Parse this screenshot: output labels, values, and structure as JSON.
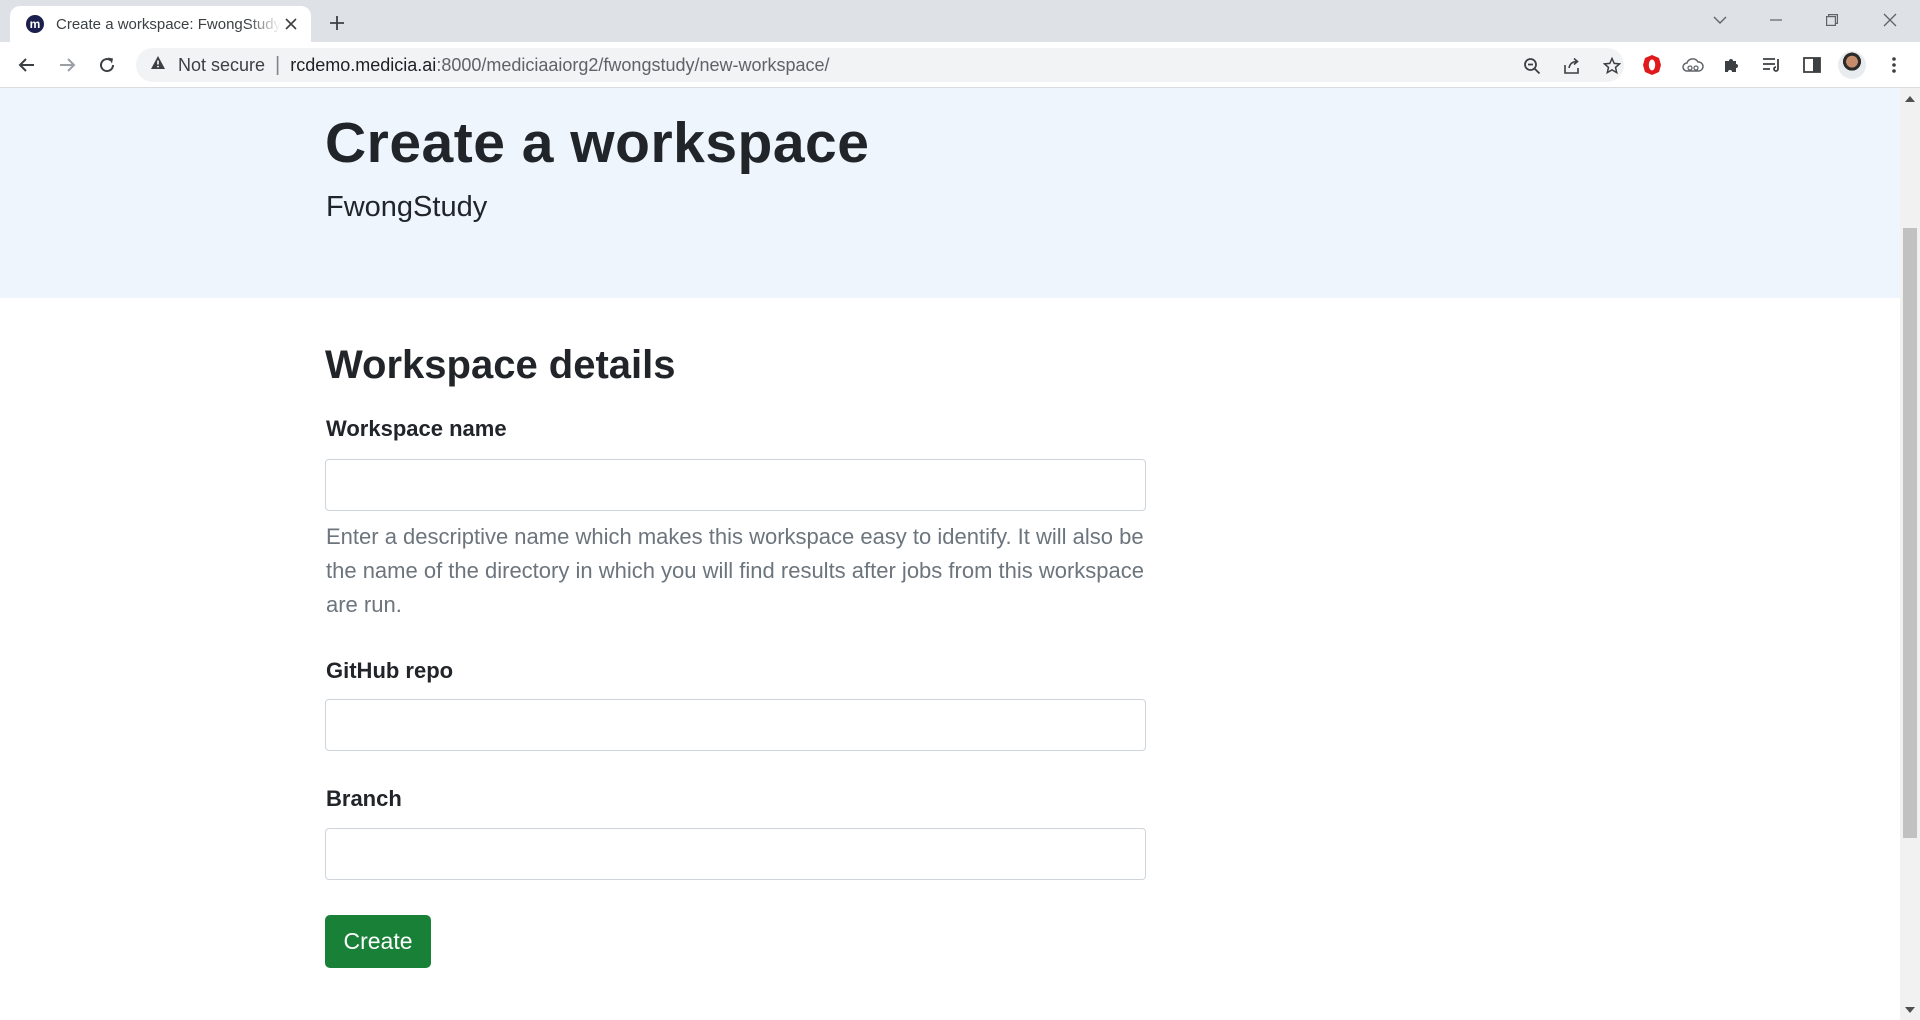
{
  "browser": {
    "tab_title": "Create a workspace: FwongStudy",
    "favicon_letter": "m",
    "security_label": "Not secure",
    "url_host": "rcdemo.medicia.ai",
    "url_path": ":8000/mediciaaiorg2/fwongstudy/new-workspace/",
    "icons": [
      "back-arrow-icon",
      "forward-arrow-icon",
      "reload-icon",
      "warning-icon",
      "zoom-out-icon",
      "share-icon",
      "star-icon",
      "opera-extension-icon",
      "cloud-extension-icon",
      "puzzle-extensions-icon",
      "reading-list-icon",
      "side-panel-icon",
      "kebab-menu-icon"
    ]
  },
  "hero": {
    "title": "Create a workspace",
    "subtitle": "FwongStudy"
  },
  "form": {
    "section_title": "Workspace details",
    "workspace_name": {
      "label": "Workspace name",
      "value": "",
      "help": "Enter a descriptive name which makes this workspace easy to identify. It will also be the name of the directory in which you will find results after jobs from this workspace are run."
    },
    "github_repo": {
      "label": "GitHub repo",
      "value": ""
    },
    "branch": {
      "label": "Branch",
      "value": ""
    },
    "submit_label": "Create"
  },
  "colors": {
    "hero_background": "#eef5fd",
    "primary_button": "#198038",
    "help_text": "#6c757d"
  }
}
